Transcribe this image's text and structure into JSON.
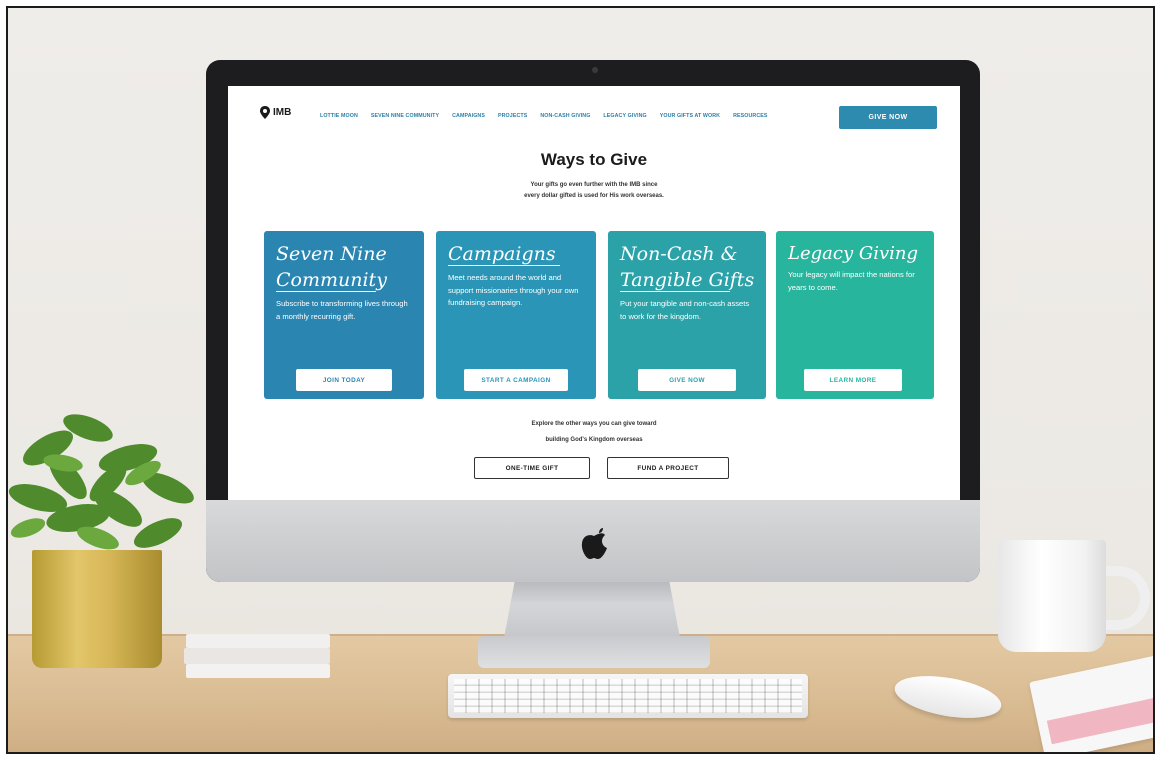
{
  "site": {
    "logo_text": "IMB",
    "nav": [
      {
        "label": "LOTTIE MOON"
      },
      {
        "label": "SEVEN NINE COMMUNITY"
      },
      {
        "label": "CAMPAIGNS"
      },
      {
        "label": "PROJECTS"
      },
      {
        "label": "NON-CASH GIVING"
      },
      {
        "label": "LEGACY GIVING"
      },
      {
        "label": "YOUR GIFTS AT WORK"
      },
      {
        "label": "RESOURCES"
      }
    ],
    "give_now_label": "GIVE NOW"
  },
  "page": {
    "title": "Ways to Give",
    "intro_line1": "Your gifts go even further with the IMB since",
    "intro_line2": "every dollar gifted is used for His work overseas."
  },
  "cards": [
    {
      "title_line1": "Seven Nine",
      "title_line2": "Community",
      "body": "Subscribe to transforming lives through a monthly recurring gift.",
      "button": "JOIN TODAY",
      "color": "#2a85b1"
    },
    {
      "title_line1": "Campaigns",
      "title_line2": "",
      "body": "Meet needs around the world and support missionaries through your own fundraising campaign.",
      "button": "START A CAMPAIGN",
      "color": "#2a95b6"
    },
    {
      "title_line1": "Non-Cash &",
      "title_line2": "Tangible Gifts",
      "body": "Put your tangible and non-cash assets to work for the kingdom.",
      "button": "GIVE NOW",
      "color": "#2aa2a8"
    },
    {
      "title_line1": "Legacy Giving",
      "title_line2": "",
      "body": "Your legacy will impact the nations for years to come.",
      "button": "LEARN MORE",
      "color": "#28b59e"
    }
  ],
  "explore": {
    "line1": "Explore the other ways you can give toward",
    "line2": "building God's Kingdom overseas",
    "buttons": [
      "ONE-TIME GIFT",
      "FUND A PROJECT"
    ]
  },
  "colors": {
    "accent": "#2e8bb0",
    "nav_link": "#2a7fa8"
  }
}
